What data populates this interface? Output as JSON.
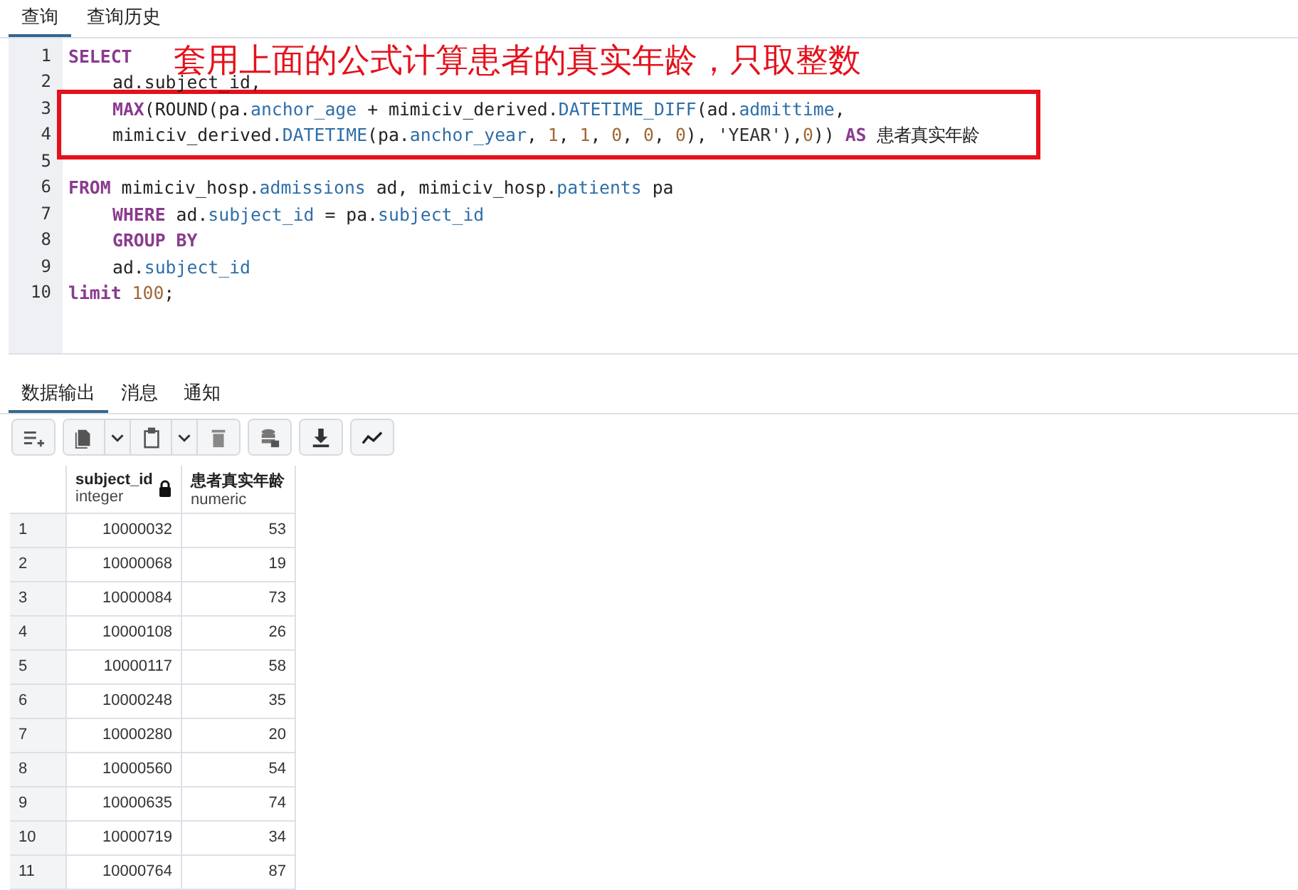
{
  "query_tabs": [
    {
      "label": "查询",
      "selected": true
    },
    {
      "label": "查询历史",
      "selected": false
    }
  ],
  "annotation": {
    "text": "套用上面的公式计算患者的真实年龄，只取整数"
  },
  "code_lines": [
    {
      "kind": "line",
      "number": "1",
      "indented": false,
      "tokens": [
        {
          "kind": "keyword",
          "text": "SELECT"
        }
      ]
    },
    {
      "kind": "line",
      "number": "2",
      "indented": true,
      "tokens": [
        {
          "kind": "plain",
          "text": "ad.subject_id,"
        }
      ]
    },
    {
      "kind": "frame",
      "lines": [
        {
          "kind": "line",
          "number": "3",
          "indented": true,
          "tokens": [
            {
              "kind": "keyword",
              "text": "MAX"
            },
            {
              "kind": "plain",
              "text": "(ROUND(pa."
            },
            {
              "kind": "ident",
              "text": "anchor_age"
            },
            {
              "kind": "plain",
              "text": " + mimiciv_derived."
            },
            {
              "kind": "ident",
              "text": "DATETIME_DIFF"
            },
            {
              "kind": "plain",
              "text": "(ad."
            },
            {
              "kind": "ident",
              "text": "admittime"
            },
            {
              "kind": "plain",
              "text": ","
            }
          ]
        },
        {
          "kind": "line",
          "number": "4",
          "indented": true,
          "tokens": [
            {
              "kind": "plain",
              "text": "mimiciv_derived."
            },
            {
              "kind": "ident",
              "text": "DATETIME"
            },
            {
              "kind": "plain",
              "text": "(pa."
            },
            {
              "kind": "ident",
              "text": "anchor_year"
            },
            {
              "kind": "plain",
              "text": ", "
            },
            {
              "kind": "number",
              "text": "1"
            },
            {
              "kind": "plain",
              "text": ", "
            },
            {
              "kind": "number",
              "text": "1"
            },
            {
              "kind": "plain",
              "text": ", "
            },
            {
              "kind": "number",
              "text": "0"
            },
            {
              "kind": "plain",
              "text": ", "
            },
            {
              "kind": "number",
              "text": "0"
            },
            {
              "kind": "plain",
              "text": ", "
            },
            {
              "kind": "number",
              "text": "0"
            },
            {
              "kind": "plain",
              "text": "), "
            },
            {
              "kind": "string",
              "text": "'YEAR'"
            },
            {
              "kind": "plain",
              "text": "),"
            },
            {
              "kind": "number",
              "text": "0"
            },
            {
              "kind": "plain",
              "text": ")) "
            },
            {
              "kind": "keyword",
              "text": "AS"
            },
            {
              "kind": "plain",
              "text": " 患者真实年龄"
            }
          ]
        }
      ]
    },
    {
      "kind": "blank",
      "number": "5"
    },
    {
      "kind": "line",
      "number": "6",
      "indented": false,
      "tokens": [
        {
          "kind": "keyword",
          "text": "FROM"
        },
        {
          "kind": "plain",
          "text": " mimiciv_hosp."
        },
        {
          "kind": "ident",
          "text": "admissions"
        },
        {
          "kind": "plain",
          "text": " ad, mimiciv_hosp."
        },
        {
          "kind": "ident",
          "text": "patients"
        },
        {
          "kind": "plain",
          "text": " pa"
        }
      ]
    },
    {
      "kind": "line",
      "number": "7",
      "indented": true,
      "tokens": [
        {
          "kind": "keyword",
          "text": "WHERE"
        },
        {
          "kind": "plain",
          "text": " ad."
        },
        {
          "kind": "ident",
          "text": "subject_id"
        },
        {
          "kind": "plain",
          "text": " = pa."
        },
        {
          "kind": "ident",
          "text": "subject_id"
        }
      ]
    },
    {
      "kind": "line",
      "number": "8",
      "indented": true,
      "tokens": [
        {
          "kind": "keyword",
          "text": "GROUP BY"
        }
      ]
    },
    {
      "kind": "line",
      "number": "9",
      "indented": true,
      "tokens": [
        {
          "kind": "plain",
          "text": "ad."
        },
        {
          "kind": "ident",
          "text": "subject_id"
        }
      ]
    },
    {
      "kind": "line",
      "number": "10",
      "indented": false,
      "tokens": [
        {
          "kind": "keyword",
          "text": "limit"
        },
        {
          "kind": "number",
          "text": " 100"
        },
        {
          "kind": "plain",
          "text": ";"
        }
      ]
    }
  ],
  "output_tabs": [
    {
      "label": "数据输出",
      "selected": true
    },
    {
      "label": "消息",
      "selected": false
    },
    {
      "label": "通知",
      "selected": false
    }
  ],
  "table": {
    "columns": [
      {
        "name": "subject_id",
        "type": "integer",
        "read_only": true
      },
      {
        "name": "患者真实年龄",
        "type": "numeric",
        "read_only": false
      }
    ],
    "rows": [
      {
        "number": "1",
        "cells": [
          "10000032",
          "53"
        ]
      },
      {
        "number": "2",
        "cells": [
          "10000068",
          "19"
        ]
      },
      {
        "number": "3",
        "cells": [
          "10000084",
          "73"
        ]
      },
      {
        "number": "4",
        "cells": [
          "10000108",
          "26"
        ]
      },
      {
        "number": "5",
        "cells": [
          "10000117",
          "58"
        ]
      },
      {
        "number": "6",
        "cells": [
          "10000248",
          "35"
        ]
      },
      {
        "number": "7",
        "cells": [
          "10000280",
          "20"
        ]
      },
      {
        "number": "8",
        "cells": [
          "10000560",
          "54"
        ]
      },
      {
        "number": "9",
        "cells": [
          "10000635",
          "74"
        ]
      },
      {
        "number": "10",
        "cells": [
          "10000719",
          "34"
        ]
      },
      {
        "number": "11",
        "cells": [
          "10000764",
          "87"
        ]
      }
    ]
  }
}
